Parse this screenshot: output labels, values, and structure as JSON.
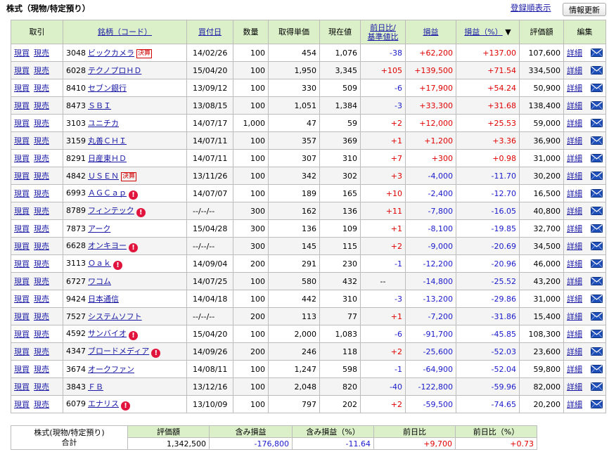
{
  "header": {
    "title": "株式（現物/特定預り）",
    "reg_order_link": "登録順表示",
    "refresh_button": "情報更新"
  },
  "columns": {
    "trade": "取引",
    "name": "銘柄（コード）",
    "buy_date": "買付日",
    "qty": "数量",
    "avg_cost": "取得単価",
    "price": "現在値",
    "day_change_1": "前日比/",
    "day_change_2": "基準値比",
    "pl": "損益",
    "pl_pct": "損益（%）",
    "sort_mark": "▼",
    "value": "評価額",
    "edit": "編集"
  },
  "labels": {
    "buy": "現買",
    "sell": "現売",
    "detail": "詳細",
    "settle_badge": "決算",
    "alert_mark": "!"
  },
  "icons": {
    "mail": "mail-icon",
    "alert": "alert-icon"
  },
  "colors": {
    "header_bg": "#dbf0c9",
    "positive": "#e00000",
    "negative": "#1a1acc",
    "link": "#1a1aa6"
  },
  "rows": [
    {
      "code": "3048",
      "name": "ビックカメラ",
      "badge": "settle",
      "date": "14/02/26",
      "qty": "100",
      "cost": "454",
      "price": "1,076",
      "chg": "-38",
      "pl": "+62,200",
      "pct": "+137.00",
      "value": "107,600"
    },
    {
      "code": "6028",
      "name": "テクノプロＨＤ",
      "badge": "",
      "date": "15/04/20",
      "qty": "100",
      "cost": "1,950",
      "price": "3,345",
      "chg": "+105",
      "pl": "+139,500",
      "pct": "+71.54",
      "value": "334,500"
    },
    {
      "code": "8410",
      "name": "セブン銀行",
      "badge": "",
      "date": "13/09/12",
      "qty": "100",
      "cost": "330",
      "price": "509",
      "chg": "-6",
      "pl": "+17,900",
      "pct": "+54.24",
      "value": "50,900"
    },
    {
      "code": "8473",
      "name": "ＳＢＩ",
      "badge": "",
      "date": "13/08/15",
      "qty": "100",
      "cost": "1,051",
      "price": "1,384",
      "chg": "-3",
      "pl": "+33,300",
      "pct": "+31.68",
      "value": "138,400"
    },
    {
      "code": "3103",
      "name": "ユニチカ",
      "badge": "",
      "date": "14/07/17",
      "qty": "1,000",
      "cost": "47",
      "price": "59",
      "chg": "+2",
      "pl": "+12,000",
      "pct": "+25.53",
      "value": "59,000"
    },
    {
      "code": "3159",
      "name": "丸善ＣＨＩ",
      "badge": "",
      "date": "14/07/11",
      "qty": "100",
      "cost": "357",
      "price": "369",
      "chg": "+1",
      "pl": "+1,200",
      "pct": "+3.36",
      "value": "36,900"
    },
    {
      "code": "8291",
      "name": "日産東ＨＤ",
      "badge": "",
      "date": "14/07/11",
      "qty": "100",
      "cost": "307",
      "price": "310",
      "chg": "+7",
      "pl": "+300",
      "pct": "+0.98",
      "value": "31,000"
    },
    {
      "code": "4842",
      "name": "ＵＳＥＮ",
      "badge": "settle",
      "date": "13/11/26",
      "qty": "100",
      "cost": "342",
      "price": "302",
      "chg": "+3",
      "pl": "-4,000",
      "pct": "-11.70",
      "value": "30,200"
    },
    {
      "code": "6993",
      "name": "ＡＧＣａｐ",
      "badge": "alert",
      "date": "14/07/07",
      "qty": "100",
      "cost": "189",
      "price": "165",
      "chg": "+10",
      "pl": "-2,400",
      "pct": "-12.70",
      "value": "16,500"
    },
    {
      "code": "8789",
      "name": "フィンテック",
      "badge": "alert",
      "date": "--/--/--",
      "qty": "300",
      "cost": "162",
      "price": "136",
      "chg": "+11",
      "pl": "-7,800",
      "pct": "-16.05",
      "value": "40,800"
    },
    {
      "code": "7873",
      "name": "アーク",
      "badge": "",
      "date": "15/04/28",
      "qty": "300",
      "cost": "136",
      "price": "109",
      "chg": "+1",
      "pl": "-8,100",
      "pct": "-19.85",
      "value": "32,700"
    },
    {
      "code": "6628",
      "name": "オンキヨー",
      "badge": "alert",
      "date": "--/--/--",
      "qty": "300",
      "cost": "145",
      "price": "115",
      "chg": "+2",
      "pl": "-9,000",
      "pct": "-20.69",
      "value": "34,500"
    },
    {
      "code": "3113",
      "name": "Ｏａｋ",
      "badge": "alert",
      "date": "14/09/04",
      "qty": "200",
      "cost": "291",
      "price": "230",
      "chg": "-1",
      "pl": "-12,200",
      "pct": "-20.96",
      "value": "46,000"
    },
    {
      "code": "6727",
      "name": "ワコム",
      "badge": "",
      "date": "14/07/25",
      "qty": "100",
      "cost": "580",
      "price": "432",
      "chg": "--",
      "pl": "-14,800",
      "pct": "-25.52",
      "value": "43,200"
    },
    {
      "code": "9424",
      "name": "日本通信",
      "badge": "",
      "date": "14/04/18",
      "qty": "100",
      "cost": "442",
      "price": "310",
      "chg": "-3",
      "pl": "-13,200",
      "pct": "-29.86",
      "value": "31,000"
    },
    {
      "code": "7527",
      "name": "システムソフト",
      "badge": "",
      "date": "--/--/--",
      "qty": "200",
      "cost": "113",
      "price": "77",
      "chg": "+1",
      "pl": "-7,200",
      "pct": "-31.86",
      "value": "15,400"
    },
    {
      "code": "4592",
      "name": "サンバイオ",
      "badge": "alert",
      "date": "15/04/20",
      "qty": "100",
      "cost": "2,000",
      "price": "1,083",
      "chg": "-6",
      "pl": "-91,700",
      "pct": "-45.85",
      "value": "108,300"
    },
    {
      "code": "4347",
      "name": "ブロードメディア",
      "badge": "alert",
      "date": "14/09/26",
      "qty": "200",
      "cost": "246",
      "price": "118",
      "chg": "+2",
      "pl": "-25,600",
      "pct": "-52.03",
      "value": "23,600"
    },
    {
      "code": "3674",
      "name": "オークファン",
      "badge": "",
      "date": "14/08/11",
      "qty": "100",
      "cost": "1,247",
      "price": "598",
      "chg": "-1",
      "pl": "-64,900",
      "pct": "-52.04",
      "value": "59,800"
    },
    {
      "code": "3843",
      "name": "ＦＢ",
      "badge": "",
      "date": "13/12/16",
      "qty": "100",
      "cost": "2,048",
      "price": "820",
      "chg": "-40",
      "pl": "-122,800",
      "pct": "-59.96",
      "value": "82,000"
    },
    {
      "code": "6079",
      "name": "エナリス",
      "badge": "alert",
      "date": "13/10/09",
      "qty": "100",
      "cost": "797",
      "price": "202",
      "chg": "+2",
      "pl": "-59,500",
      "pct": "-74.65",
      "value": "20,200"
    }
  ],
  "summary": {
    "label_1": "株式(現物/特定預り)",
    "label_2": "合計",
    "h_value": "評価額",
    "h_pl": "含み損益",
    "h_pl_pct": "含み損益（%）",
    "h_day": "前日比",
    "h_day_pct": "前日比（%）",
    "value": "1,342,500",
    "pl": "-176,800",
    "pl_pct": "-11.64",
    "day": "+9,700",
    "day_pct": "+0.73"
  }
}
